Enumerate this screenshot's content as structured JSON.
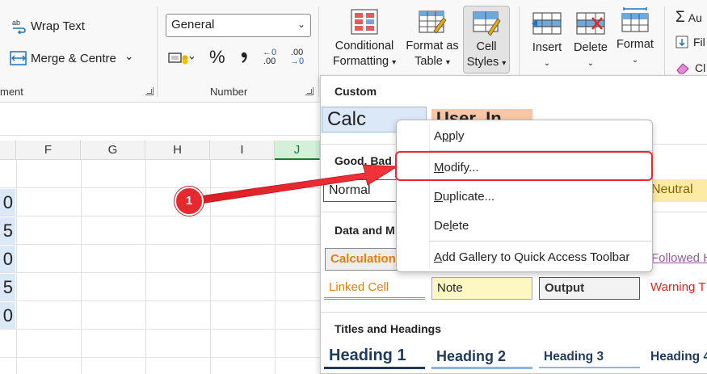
{
  "ribbon": {
    "alignment": {
      "wrap_text": "Wrap Text",
      "merge_centre": "Merge & Centre",
      "group_label": "ment"
    },
    "number": {
      "format_value": "General",
      "percent_glyph": "%",
      "comma_glyph": "❩",
      "inc_decimal_top": "←0",
      "inc_decimal_bottom": ".00",
      "dec_decimal_top": ".00",
      "dec_decimal_bottom": "→0",
      "group_label": "Number"
    },
    "styles": {
      "conditional_formatting_line1": "Conditional",
      "conditional_formatting_line2": "Formatting",
      "format_as_table_line1": "Format as",
      "format_as_table_line2": "Table",
      "cell_styles_line1": "Cell",
      "cell_styles_line2": "Styles"
    },
    "cells": {
      "insert": "Insert",
      "delete": "Delete",
      "format": "Format"
    },
    "editing": {
      "autosum": "Au",
      "fill": "Fil",
      "clear": "Cl"
    },
    "dropdown_chevron": "⌄"
  },
  "sheet": {
    "columns": [
      "F",
      "G",
      "H",
      "I",
      "J"
    ],
    "selected_column": "J",
    "cell_values": [
      "0",
      "5",
      "0",
      "5",
      "0"
    ]
  },
  "gallery": {
    "sections": {
      "custom": "Custom",
      "good_bad": "Good, Bad",
      "data_model": "Data and M",
      "titles_headings": "Titles and Headings"
    },
    "tiles": {
      "calc": "Calc",
      "user_in": "User_In",
      "normal": "Normal",
      "neutral": "Neutral",
      "calculation": "Calculation",
      "followed": "Followed H",
      "linked_cell": "Linked Cell",
      "note": "Note",
      "output": "Output",
      "warning": "Warning T",
      "heading1": "Heading 1",
      "heading2": "Heading 2",
      "heading3": "Heading 3",
      "heading4": "Heading 4"
    }
  },
  "context_menu": {
    "items": [
      {
        "label": "Apply",
        "underline": "p",
        "pre": "A",
        "post": "ply"
      },
      {
        "label": "Modify...",
        "underline": "M",
        "pre": "",
        "post": "odify..."
      },
      {
        "label": "Duplicate...",
        "underline": "D",
        "pre": "",
        "post": "uplicate..."
      },
      {
        "label": "Delete",
        "underline": "l",
        "pre": "De",
        "post": "ete"
      },
      {
        "label": "Add Gallery to Quick Access Toolbar",
        "underline": "A",
        "pre": "",
        "post": "dd Gallery to Quick Access Toolbar"
      }
    ]
  },
  "annotation": {
    "badge_number": "1"
  },
  "colors": {
    "accent_red": "#e8282e",
    "selected_col_green": "#137e3a",
    "calc_blue": "#dbe8f7",
    "user_in_orange": "#f6c6a6",
    "neutral_yellow": "#fbeba5",
    "note_yellow": "#fdf7c3",
    "heading_navy": "#1f3a5f"
  }
}
